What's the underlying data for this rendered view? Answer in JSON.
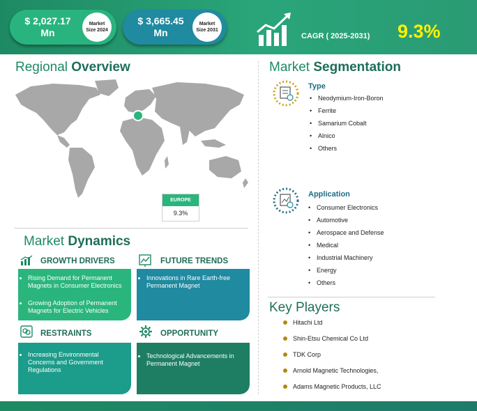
{
  "header": {
    "market_size_2024_value": "$ 2,027.17",
    "market_size_2024_unit": "Mn",
    "market_size_2024_label_1": "Market",
    "market_size_2024_label_2": "Size 2024",
    "market_size_2031_value": "$ 3,665.45",
    "market_size_2031_unit": "Mn",
    "market_size_2031_label_1": "Market",
    "market_size_2031_label_2": "Size 2031",
    "cagr_label": "CAGR ( 2025-2031)",
    "cagr_value": "9.3%",
    "colors": {
      "banner": "#1e8a63",
      "cagr": "#fff200",
      "pill_2024": "#29b47f",
      "pill_2031": "#1f8aa0"
    }
  },
  "regional": {
    "title_light": "Regional ",
    "title_bold": "Overview",
    "region_name": "EUROPE",
    "region_value": "9.3%"
  },
  "dynamics": {
    "title_light": "Market ",
    "title_bold": "Dynamics",
    "growth_title": "GROWTH DRIVERS",
    "growth_items": [
      "Rising Demand for Permanent Magnets in Consumer Electronics",
      "Growing Adoption of Permanent Magnets for Electric Vehicles"
    ],
    "trends_title": "FUTURE TRENDS",
    "trends_items": [
      "Innovations in Rare Earth-free Permanent Magnet"
    ],
    "restraints_title": "RESTRAINTS",
    "restraints_items": [
      "Increasing Environmental Concerns and Government Regulations"
    ],
    "opportunity_title": "OPPORTUNITY",
    "opportunity_items": [
      "Technological Advancements in Permanent Magnet"
    ]
  },
  "segmentation": {
    "title_light": "Market ",
    "title_bold": "Segmentation",
    "type_title": "Type",
    "type_items": [
      "Neodymium-Iron-Boron",
      "Ferrite",
      "Samarium Cobalt",
      "Alnico",
      "Others"
    ],
    "application_title": "Application",
    "application_items": [
      "Consumer Electronics",
      "Automotive",
      "Aerospace and Defense",
      "Medical",
      "Industrial Machinery",
      "Energy",
      "Others"
    ]
  },
  "players": {
    "title": "Key Players",
    "items": [
      "Hitachi Ltd",
      "Shin-Etsu Chemical Co Ltd",
      "TDK Corp",
      "Arnold Magnetic Technologies,",
      "Adams Magnetic Products, LLC"
    ]
  }
}
